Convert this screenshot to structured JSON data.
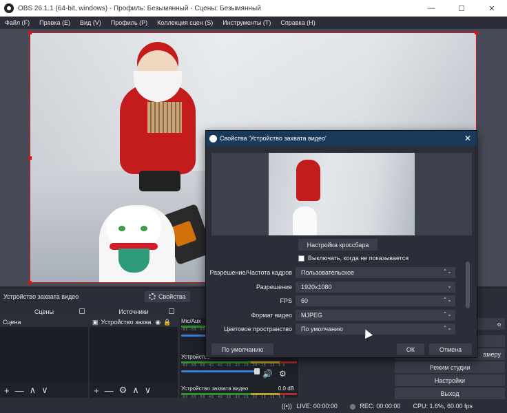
{
  "window": {
    "title": "OBS 26.1.1 (64-bit, windows) - Профиль: Безымянный - Сцены: Безымянный"
  },
  "menu": [
    "Файл (F)",
    "Правка (E)",
    "Вид (V)",
    "Профиль (P)",
    "Коллекция сцен (S)",
    "Инструменты (T)",
    "Справка (H)"
  ],
  "source_bar": {
    "name": "Устройство захвата видео",
    "properties_label": "Свойства"
  },
  "scenes": {
    "title": "Сцены",
    "items": [
      "Сцена"
    ]
  },
  "sources": {
    "title": "Источники",
    "items": [
      "Устройство захва"
    ]
  },
  "mixer": {
    "channels": [
      {
        "name": "Mic/Aux",
        "db": ""
      },
      {
        "name": "Устройство",
        "db": ""
      },
      {
        "name": "Устройство захвата видео",
        "db": "0.0 dB"
      }
    ],
    "ticks": "-60 -55 -50 -45 -40 -35 -30 -25 -20 -15 -10 -5 0"
  },
  "controls": {
    "partial_1": "о",
    "partial_2": "амеру",
    "studio_mode": "Режим студии",
    "settings": "Настройки",
    "exit": "Выход"
  },
  "status": {
    "live": "LIVE: 00:00:00",
    "rec": "REC: 00:00:00",
    "cpu": "CPU: 1.6%, 60.00 fps"
  },
  "dialog": {
    "title": "Свойства 'Устройство захвата видео'",
    "crossbar_button": "Настройка кроссбара",
    "checkbox_label": "Выключать, когда не показывается",
    "fields": [
      {
        "label": "Разрешение/Частота кадров",
        "value": "Пользовательское"
      },
      {
        "label": "Разрешение",
        "value": "1920x1080"
      },
      {
        "label": "FPS",
        "value": "60"
      },
      {
        "label": "Формат видео",
        "value": "MJPEG"
      },
      {
        "label": "Цветовое пространство",
        "value": "По умолчанию"
      }
    ],
    "defaults_button": "По умолчанию",
    "ok_button": "ОК",
    "cancel_button": "Отмена"
  }
}
